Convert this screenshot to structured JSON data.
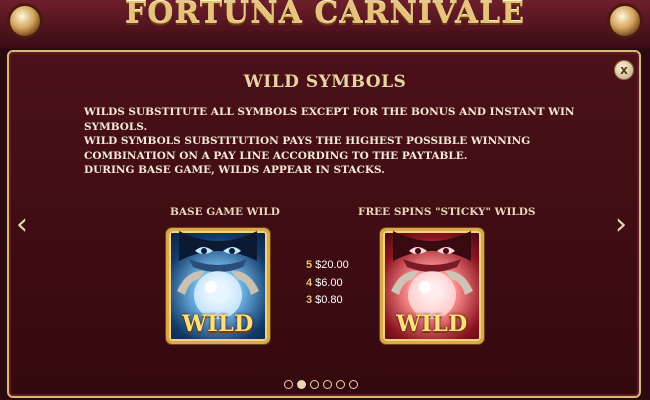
{
  "game_title": "FORTUNA CARNIVALE",
  "heading": "WILD SYMBOLS",
  "description": [
    "WILDS SUBSTITUTE ALL SYMBOLS EXCEPT FOR THE BONUS AND INSTANT WIN SYMBOLS.",
    "WILD SYMBOLS SUBSTITUTION PAYS THE HIGHEST POSSIBLE WINNING COMBINATION ON A PAY LINE ACCORDING TO THE PAYTABLE.",
    "DURING BASE GAME, WILDS APPEAR IN STACKS."
  ],
  "close_label": "x",
  "nav": {
    "prev": "‹",
    "next": "›"
  },
  "symbols": [
    {
      "label": "BASE GAME WILD",
      "badge": "WILD",
      "color": "#1e5aa0"
    },
    {
      "label": "FREE SPINS \"STICKY\" WILDS",
      "badge": "WILD",
      "color": "#b01e2a"
    }
  ],
  "payouts": [
    {
      "count": "5",
      "amount": "$20.00"
    },
    {
      "count": "4",
      "amount": "$6.00"
    },
    {
      "count": "3",
      "amount": "$0.80"
    }
  ],
  "pagination": {
    "total": 6,
    "active_index": 1
  },
  "colors": {
    "accent_gold": "#e7c27a",
    "panel_bg": "#3e0d13"
  }
}
